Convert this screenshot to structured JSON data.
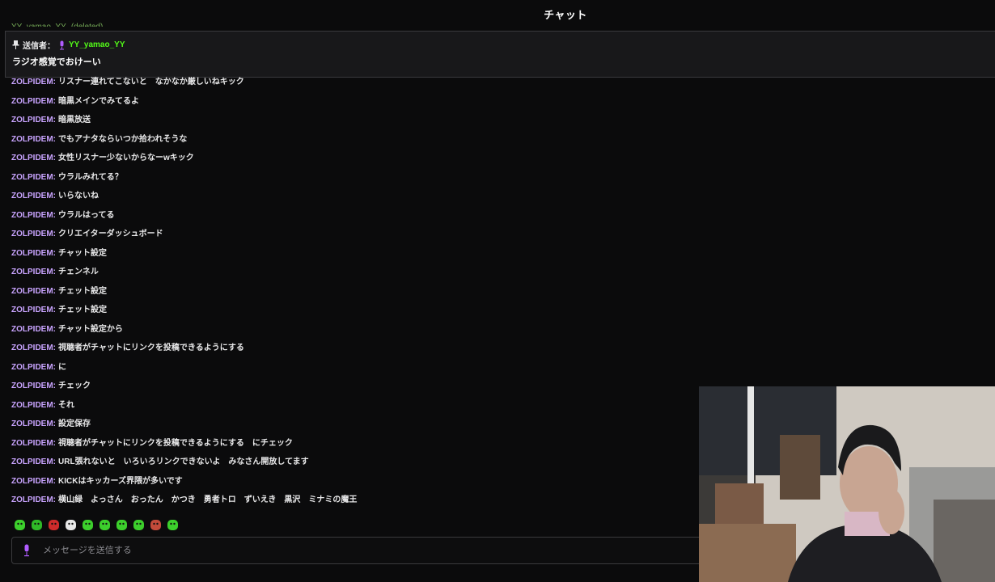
{
  "header": {
    "title": "チャット"
  },
  "ghost_row": {
    "user": "YY_yamao_YY",
    "badge": "(deleted)"
  },
  "pinned": {
    "label": "送信者：",
    "user": "YY_yamao_YY",
    "text": "ラジオ感覚でおけーい"
  },
  "messages": [
    {
      "user": "ZOLPIDEM",
      "text": "リスナー連れてこないと　なかなか厳しいねキック"
    },
    {
      "user": "ZOLPIDEM",
      "text": "暗黒メインでみてるよ"
    },
    {
      "user": "ZOLPIDEM",
      "text": "暗黒放送"
    },
    {
      "user": "ZOLPIDEM",
      "text": "でもアナタならいつか拾われそうな"
    },
    {
      "user": "ZOLPIDEM",
      "text": "女性リスナー少ないからなーwキック"
    },
    {
      "user": "ZOLPIDEM",
      "text": "ウラルみれてる？"
    },
    {
      "user": "ZOLPIDEM",
      "text": "いらないね"
    },
    {
      "user": "ZOLPIDEM",
      "text": "ウラルはってる"
    },
    {
      "user": "ZOLPIDEM",
      "text": "クリエイターダッシュボード"
    },
    {
      "user": "ZOLPIDEM",
      "text": "チャット設定"
    },
    {
      "user": "ZOLPIDEM",
      "text": "チェンネル"
    },
    {
      "user": "ZOLPIDEM",
      "text": "チェット設定"
    },
    {
      "user": "ZOLPIDEM",
      "text": "チェット設定"
    },
    {
      "user": "ZOLPIDEM",
      "text": "チャット設定から"
    },
    {
      "user": "ZOLPIDEM",
      "text": "視聴者がチャットにリンクを投稿できるようにする"
    },
    {
      "user": "ZOLPIDEM",
      "text": "に"
    },
    {
      "user": "ZOLPIDEM",
      "text": "チェック"
    },
    {
      "user": "ZOLPIDEM",
      "text": "それ"
    },
    {
      "user": "ZOLPIDEM",
      "text": "設定保存"
    },
    {
      "user": "ZOLPIDEM",
      "text": "視聴者がチャットにリンクを投稿できるようにする　にチェック"
    },
    {
      "user": "ZOLPIDEM",
      "text": "URL張れないと　いろいろリンクできないよ　みなさん開放してます"
    },
    {
      "user": "ZOLPIDEM",
      "text": "KICKはキッカーズ界隈が多いです"
    },
    {
      "user": "ZOLPIDEM",
      "text": "横山緑　よっさん　おったん　かつき　勇者トロ　ずいえき　黒沢　ミナミの魔王"
    }
  ],
  "emotes": [
    "kick-green-emote",
    "kick-cup-emote",
    "kick-red-emote",
    "kick-panda-emote",
    "kick-smile-emote",
    "kick-mushroom-emote",
    "kick-happy-emote",
    "kick-grin-emote",
    "kick-face-emote",
    "kick-hand-emote"
  ],
  "input": {
    "placeholder": "メッセージを送信する"
  },
  "colors": {
    "username": "#c9a4ff",
    "kick_green": "#53fc18",
    "background": "#0b0b0c",
    "pinned_background": "#18181a"
  }
}
